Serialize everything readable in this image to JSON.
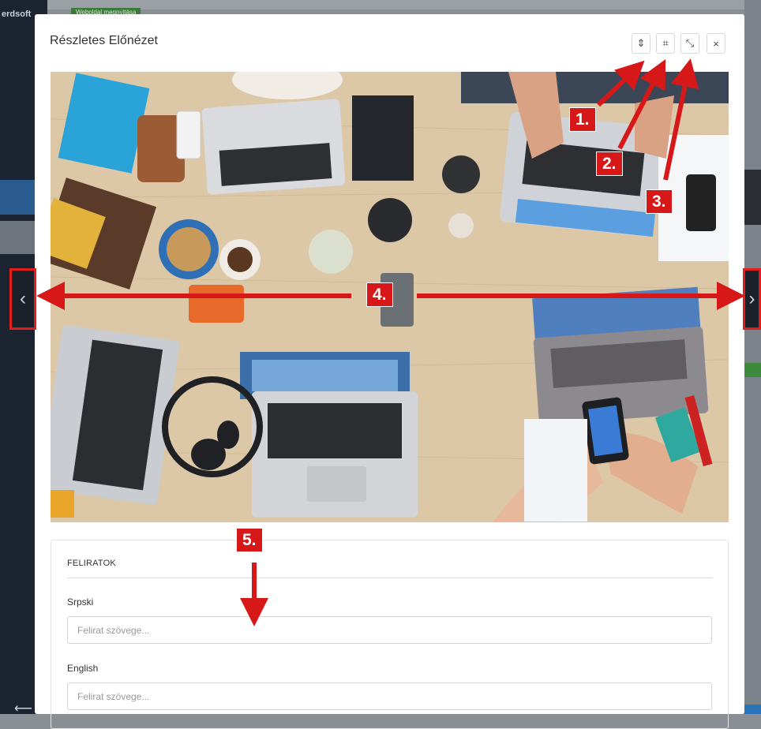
{
  "background": {
    "brand_text": "erdsoft",
    "website_button": "Weboldal megnyitása"
  },
  "modal": {
    "title": "Részletes Előnézet",
    "toolbar": [
      {
        "icon": "vertical-resize-icon",
        "glyph": "⇕"
      },
      {
        "icon": "fit-screen-icon",
        "glyph": "⌗"
      },
      {
        "icon": "no-magic-icon",
        "glyph": "⤡"
      },
      {
        "icon": "close-icon",
        "glyph": "×"
      }
    ],
    "captions": {
      "section_title": "FELIRATOK",
      "languages": [
        {
          "label": "Srpski",
          "placeholder": "Felirat szövege..."
        },
        {
          "label": "English",
          "placeholder": "Felirat szövege..."
        }
      ]
    }
  },
  "nav": {
    "prev_glyph": "‹",
    "next_glyph": "›"
  },
  "annotations": {
    "labels": [
      "1.",
      "2.",
      "3.",
      "4.",
      "5."
    ],
    "arrow_color": "#d61818"
  }
}
